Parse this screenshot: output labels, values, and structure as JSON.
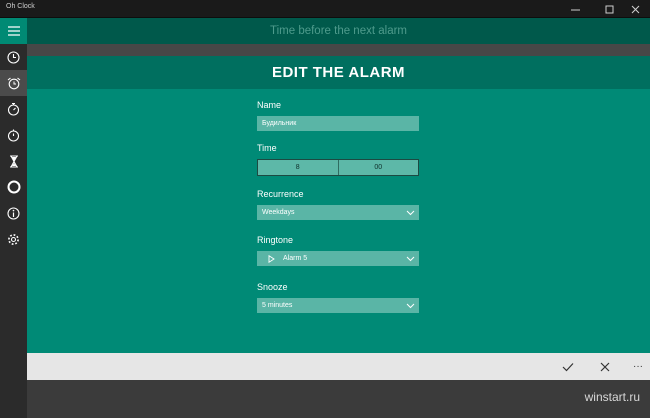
{
  "window": {
    "title": "Oh Clock"
  },
  "sidebar": {
    "items": [
      {
        "icon": "hamburger-icon"
      },
      {
        "icon": "clock-icon"
      },
      {
        "icon": "alarm-icon"
      },
      {
        "icon": "stopwatch-icon"
      },
      {
        "icon": "timer-icon"
      },
      {
        "icon": "hourglass-icon"
      },
      {
        "icon": "circle-icon"
      },
      {
        "icon": "info-icon"
      },
      {
        "icon": "gear-icon"
      }
    ]
  },
  "topbar": {
    "text": "Time before the next alarm"
  },
  "panel": {
    "title": "EDIT THE ALARM",
    "name_label": "Name",
    "name_value": "Будильник",
    "time_label": "Time",
    "time_hour": "8",
    "time_minute": "00",
    "recurrence_label": "Recurrence",
    "recurrence_value": "Weekdays",
    "ringtone_label": "Ringtone",
    "ringtone_value": "Alarm 5",
    "snooze_label": "Snooze",
    "snooze_value": "5 minutes"
  },
  "bottombar": {
    "more_label": "···"
  },
  "watermark": "winstart.ru"
}
